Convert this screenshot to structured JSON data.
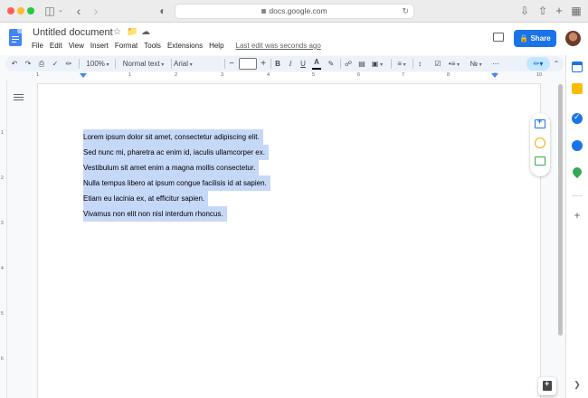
{
  "browser": {
    "url": "docs.google.com"
  },
  "document": {
    "title": "Untitled document",
    "menu": [
      "File",
      "Edit",
      "View",
      "Insert",
      "Format",
      "Tools",
      "Extensions",
      "Help"
    ],
    "last_edit": "Last edit was seconds ago",
    "share_label": "Share"
  },
  "toolbar": {
    "zoom": "100%",
    "style": "Normal text",
    "font": "Arial",
    "font_size": "",
    "bold": "B",
    "italic": "I",
    "underline": "U",
    "text_color": "A"
  },
  "ruler": {
    "h_ticks": [
      "1",
      "1",
      "2",
      "3",
      "4",
      "5",
      "6",
      "7",
      "8",
      "9",
      "10"
    ],
    "v_ticks": [
      "1",
      "2",
      "3",
      "4",
      "5",
      "6"
    ]
  },
  "paragraphs": [
    "Lorem ipsum dolor sit amet, consectetur adipiscing elit.",
    "Sed nunc mi, pharetra ac enim id, iaculis ullamcorper ex.",
    "Vestibulum sit amet enim a magna mollis consectetur.",
    "Nulla tempus libero at ipsum congue facilisis id at sapien.",
    "Etiam eu lacinia ex, at efficitur sapien.",
    "Vivamus non elit non nisl interdum rhoncus."
  ],
  "colors": {
    "selection": "#c6d8f7",
    "share_button": "#1a73e8",
    "docs_blue": "#4285f4"
  },
  "icons": {
    "sidebar": [
      "calendar-icon",
      "keep-icon",
      "tasks-icon",
      "contacts-icon",
      "maps-icon",
      "add-icon"
    ],
    "floating": [
      "add-comment-icon",
      "emoji-reaction-icon",
      "suggest-edits-icon"
    ]
  }
}
